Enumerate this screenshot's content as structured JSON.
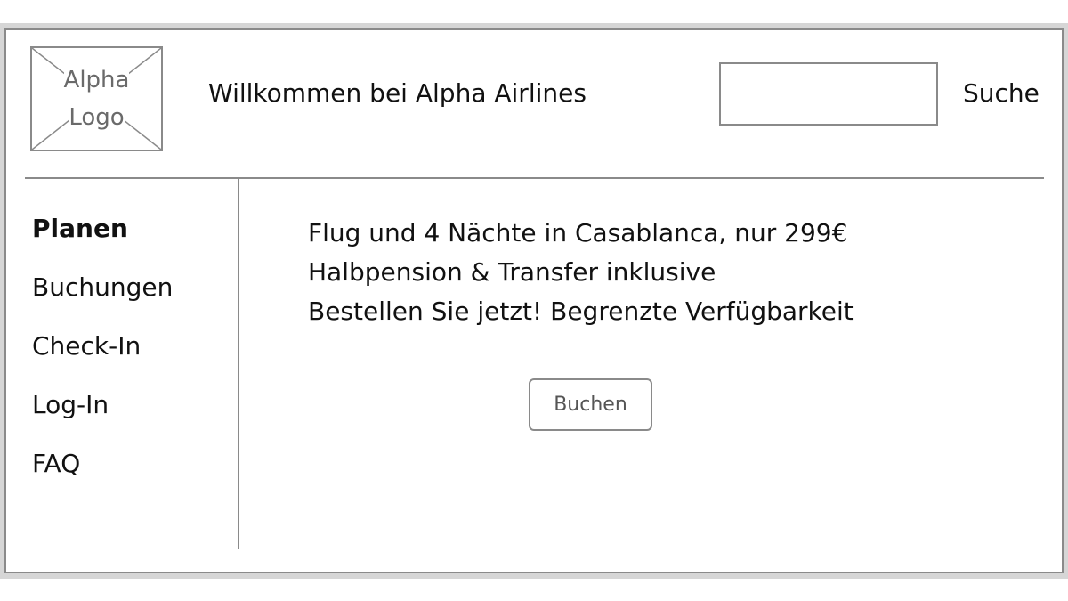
{
  "logo": {
    "line1": "Alpha",
    "line2": "Logo"
  },
  "header": {
    "welcome": "Willkommen bei Alpha Airlines"
  },
  "search": {
    "value": "",
    "placeholder": "",
    "label": "Suche"
  },
  "sidebar": {
    "items": [
      {
        "label": "Planen",
        "active": true
      },
      {
        "label": "Buchungen",
        "active": false
      },
      {
        "label": "Check-In",
        "active": false
      },
      {
        "label": "Log-In",
        "active": false
      },
      {
        "label": "FAQ",
        "active": false
      }
    ]
  },
  "main": {
    "promo_lines": [
      "Flug und 4 Nächte in Casablanca, nur 299€",
      "Halbpension & Transfer inklusive",
      "Bestellen Sie jetzt! Begrenzte Verfügbarkeit"
    ],
    "book_button": "Buchen"
  },
  "colors": {
    "border": "#8a8a8a",
    "text": "#111111",
    "muted": "#6a6a6a",
    "page_band": "#d6d6d6"
  }
}
